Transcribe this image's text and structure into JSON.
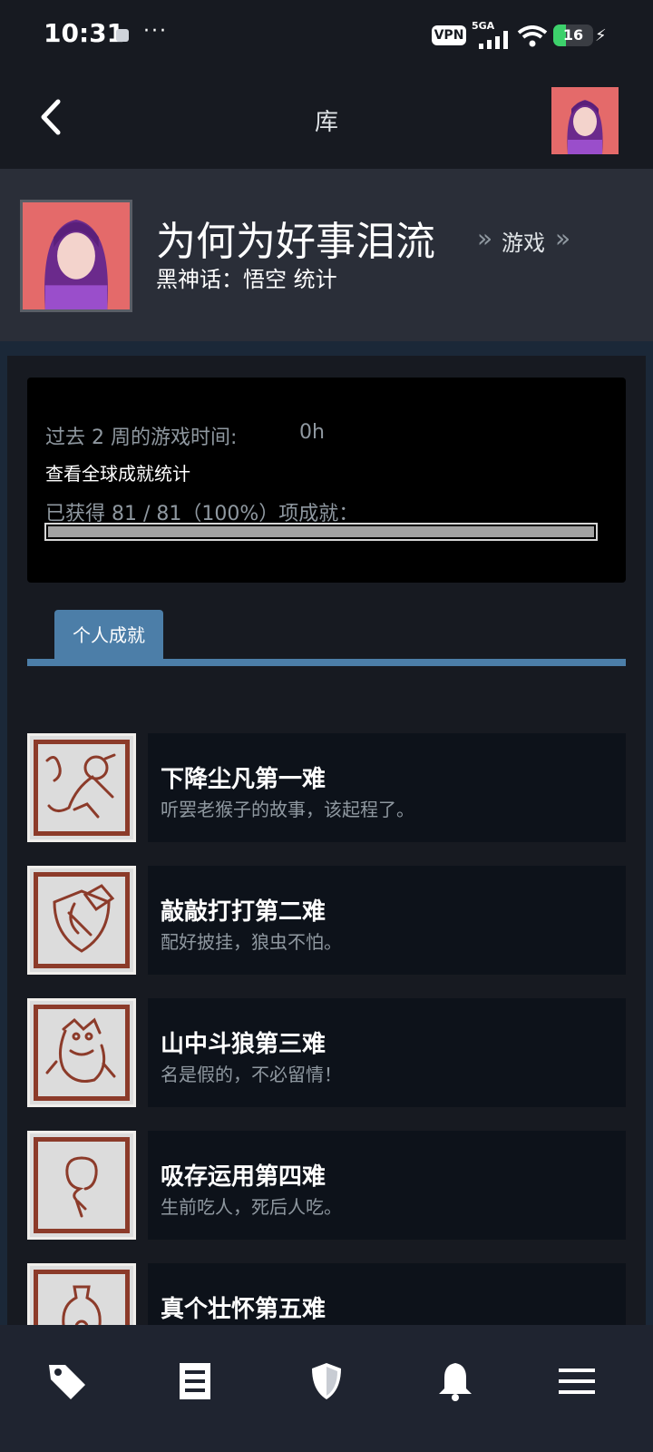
{
  "status_bar": {
    "time": "10:31",
    "dots": "···",
    "vpn": "VPN",
    "network": "5GA",
    "battery_level": "16",
    "icons": [
      "notification-icon",
      "signal-icon",
      "wifi-icon",
      "battery-icon",
      "charging-icon"
    ]
  },
  "nav": {
    "title": "库",
    "back_icon": "chevron-left-icon"
  },
  "profile": {
    "name": "为何为好事泪流",
    "crumb_sep": "»",
    "crumb_games": "游戏",
    "game_stats_title": "黑神话：悟空 统计"
  },
  "stats": {
    "playtime_label": "过去 2 周的游戏时间:",
    "playtime_value": "0h",
    "global_link": "查看全球成就统计",
    "achieved_text": "已获得 81 / 81（100%）项成就：",
    "progress": 1.0
  },
  "tabs": [
    {
      "label": "个人成就",
      "active": true
    }
  ],
  "achievements": [
    {
      "name": "下降尘凡第一难",
      "desc": "听罢老猴子的故事，该起程了。",
      "icon": "monkey-icon"
    },
    {
      "name": "敲敲打打第二难",
      "desc": "配好披挂，狼虫不怕。",
      "icon": "shield-icon"
    },
    {
      "name": "山中斗狼第三难",
      "desc": "名是假的，不必留情！",
      "icon": "wolf-icon"
    },
    {
      "name": "吸存运用第四难",
      "desc": "生前吃人，死后人吃。",
      "icon": "gourd-icon"
    },
    {
      "name": "真个壮怀第五难",
      "desc": "",
      "icon": "vase-icon"
    }
  ],
  "bottom_nav": [
    {
      "name": "store-tag-icon"
    },
    {
      "name": "library-icon"
    },
    {
      "name": "guard-shield-icon"
    },
    {
      "name": "notifications-bell-icon"
    },
    {
      "name": "menu-icon"
    }
  ],
  "colors": {
    "accent_blue": "#4c7ea8",
    "background": "#171a21",
    "card": "#0d121a",
    "icon_border": "#8c3b2a"
  }
}
